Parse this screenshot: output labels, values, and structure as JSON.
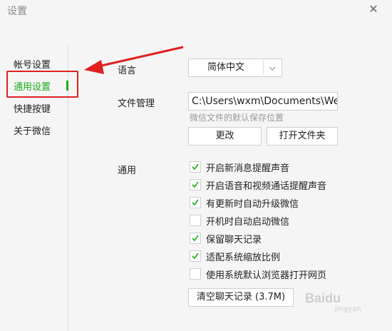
{
  "window": {
    "title": "设置",
    "close_glyph": "✕"
  },
  "sidebar": {
    "items": [
      {
        "label": "帐号设置"
      },
      {
        "label": "通用设置",
        "active": true
      },
      {
        "label": "快捷按键"
      },
      {
        "label": "关于微信"
      }
    ]
  },
  "language": {
    "label": "语言",
    "selected": "简体中文"
  },
  "file_manage": {
    "label": "文件管理",
    "path": "C:\\Users\\wxm\\Documents\\WeChat Files",
    "hint": "微信文件的默认保存位置",
    "change_button": "更改",
    "open_folder_button": "打开文件夹"
  },
  "general": {
    "label": "通用",
    "options": [
      {
        "label": "开启新消息提醒声音",
        "checked": true
      },
      {
        "label": "开启语音和视频通话提醒声音",
        "checked": true
      },
      {
        "label": "有更新时自动升级微信",
        "checked": true
      },
      {
        "label": "开机时自动启动微信",
        "checked": false
      },
      {
        "label": "保留聊天记录",
        "checked": true
      },
      {
        "label": "适配系统缩放比例",
        "checked": true
      },
      {
        "label": "使用系统默认浏览器打开网页",
        "checked": false
      }
    ],
    "clear_button": "清空聊天记录 (3.7M)"
  },
  "colors": {
    "accent": "#1aad19",
    "annotation": "#e02020"
  },
  "watermark": {
    "text": "Baidu",
    "sub": "jingyan"
  }
}
